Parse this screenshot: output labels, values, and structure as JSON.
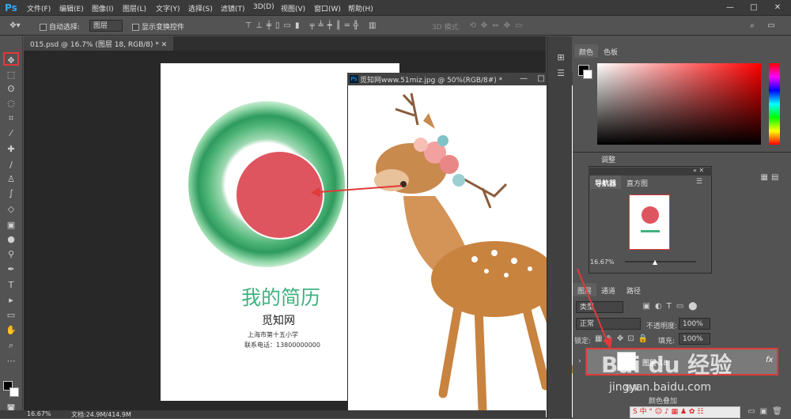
{
  "app": {
    "logo": "Ps"
  },
  "menu": [
    "文件(F)",
    "编辑(E)",
    "图像(I)",
    "图层(L)",
    "文字(Y)",
    "选择(S)",
    "滤镜(T)",
    "3D(D)",
    "视图(V)",
    "窗口(W)",
    "帮助(H)"
  ],
  "window_controls": {
    "minimize": "—",
    "maximize": "□",
    "close": "✕"
  },
  "options_bar": {
    "auto_select_label": "自动选择:",
    "auto_select_value": "图层",
    "show_transform_label": "显示变换控件",
    "mode_3d_label": "3D 模式:"
  },
  "doc_tab": {
    "label": "015.psd @ 16.7% (图层 18, RGB/8) *"
  },
  "float_window": {
    "title": "觅知网www.51miz.jpg @ 50%(RGB/8#) *"
  },
  "resume": {
    "title": "我的简历",
    "name": "觅知网",
    "school": "上海市第十五小学",
    "phone": "联系电话：13800000000"
  },
  "status": {
    "zoom": "16.67%",
    "doc_size": "文档:24.9M/414.9M"
  },
  "color_panel": {
    "tabs": [
      "颜色",
      "色板"
    ]
  },
  "adjust_panel": {
    "tab": "调整"
  },
  "navigator": {
    "tabs": [
      "导航器",
      "直方图"
    ],
    "zoom": "16.67%"
  },
  "layers_panel": {
    "tabs": [
      "图层",
      "通道",
      "路径"
    ],
    "filter_type": "类型",
    "blend_mode": "正常",
    "opacity_label": "不透明度:",
    "opacity_value": "100%",
    "lock_label": "锁定:",
    "fill_label": "填充:",
    "fill_value": "100%",
    "layer_name": "图层 18",
    "effects_label": "效果",
    "color_overlay": "颜色叠加",
    "fx": "fx"
  },
  "watermark": {
    "brand": "Bai du 经验",
    "url": "jingyan.baidu.com"
  },
  "colors": {
    "accent_red": "#e03a3a",
    "resume_green": "#3fb27f",
    "circle_red": "#de5560"
  }
}
